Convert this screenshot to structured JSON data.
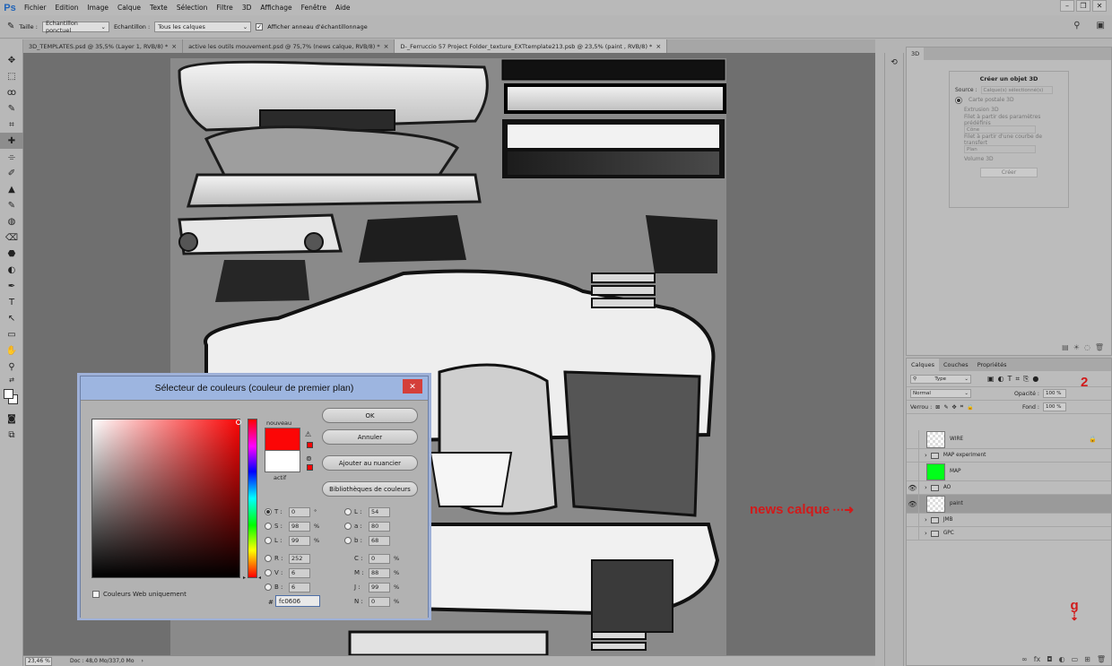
{
  "app": {
    "logo": "Ps",
    "menu": [
      "Fichier",
      "Edition",
      "Image",
      "Calque",
      "Texte",
      "Sélection",
      "Filtre",
      "3D",
      "Affichage",
      "Fenêtre",
      "Aide"
    ],
    "window_controls": [
      "–",
      "❐",
      "✕"
    ]
  },
  "options_bar": {
    "size_label": "Taille :",
    "size_value": "Echantillon ponctuel",
    "sample_label": "Echantillon :",
    "sample_value": "Tous les calques",
    "ring_label": "Afficher anneau d'échantillonnage",
    "ring_checked": true
  },
  "tabs": [
    {
      "label": "3D_TEMPLATES.psd @ 35,5% (Layer 1, RVB/8) *",
      "close": "×"
    },
    {
      "label": "active les outils mouvement.psd @ 75,7% (news calque, RVB/8) *",
      "close": "×"
    },
    {
      "label": "D-_Ferruccio 57 Project Folder_texture_EXTtemplate213.psb @ 23,5% (paint , RVB/8) *",
      "close": "×",
      "active": true
    }
  ],
  "tools": [
    "✥",
    "⬚",
    "ꝏ",
    "✎",
    "⌗",
    "✚",
    "⌯",
    "✐",
    "▲",
    "✎",
    "◍",
    "⌫",
    "⬣",
    "◐",
    "✒",
    "T",
    "↖",
    "▭",
    "✋",
    "⚲",
    "⇄"
  ],
  "status": {
    "zoom": "23,46 %",
    "doc": "Doc : 48,0 Mo/337,0 Mo"
  },
  "panel_3d": {
    "tab": "3D",
    "title": "Créer un objet 3D",
    "source_label": "Source :",
    "source_value": "Calque(s) sélectionné(s)",
    "options": [
      "Carte postale 3D",
      "Extrusion 3D",
      "Filet à partir des paramètres prédéfinis",
      "Filet à partir d'une courbe de transfert",
      "Volume 3D"
    ],
    "preset_value": "Cône",
    "curve_value": "Plan",
    "create_button": "Créer"
  },
  "layers_panel": {
    "tabs": [
      "Calques",
      "Couches",
      "Propriétés"
    ],
    "filter_value": "Type",
    "blend_mode": "Normal",
    "opacity_label": "Opacité :",
    "opacity_value": "100 %",
    "lock_label": "Verrou :",
    "fill_label": "Fond :",
    "fill_value": "100 %",
    "layers": [
      {
        "name": "WIRE",
        "kind": "layer",
        "visible": false,
        "locked": true,
        "thumb": "transparent"
      },
      {
        "name": "MAP experiment",
        "kind": "group",
        "visible": false
      },
      {
        "name": "MAP",
        "kind": "layer",
        "visible": false,
        "thumb": "green"
      },
      {
        "name": "AO",
        "kind": "group",
        "visible": true
      },
      {
        "name": "paint",
        "kind": "layer",
        "visible": true,
        "selected": true,
        "thumb": "transparent"
      },
      {
        "name": "JMB",
        "kind": "group",
        "visible": false
      },
      {
        "name": "GPC",
        "kind": "group",
        "visible": false
      }
    ],
    "footer_icons": [
      "∞",
      "fx",
      "◘",
      "◐",
      "▭",
      "⊞",
      "🗑"
    ]
  },
  "annotations": {
    "news_calque": "news calque",
    "number_two": "2",
    "letter_g": "g"
  },
  "color_picker": {
    "title": "Sélecteur de couleurs (couleur de premier plan)",
    "close": "✕",
    "new_label": "nouveau",
    "current_label": "actif",
    "new_color": "#fc0606",
    "current_color": "#ffffff",
    "buttons": {
      "ok": "OK",
      "cancel": "Annuler",
      "add_swatch": "Ajouter au nuancier",
      "libraries": "Bibliothèques de couleurs"
    },
    "hsb": {
      "T": "0",
      "S": "98",
      "L": "99",
      "T_unit": "°",
      "S_unit": "%",
      "L_unit": "%"
    },
    "rgb": {
      "R": "252",
      "V": "6",
      "B": "6"
    },
    "lab": {
      "L": "54",
      "a": "80",
      "b": "68"
    },
    "cmyk": {
      "C": "0",
      "M": "88",
      "J": "99",
      "N": "0"
    },
    "hex_label": "#",
    "hex": "fc0606",
    "web_only_label": "Couleurs Web uniquement"
  }
}
